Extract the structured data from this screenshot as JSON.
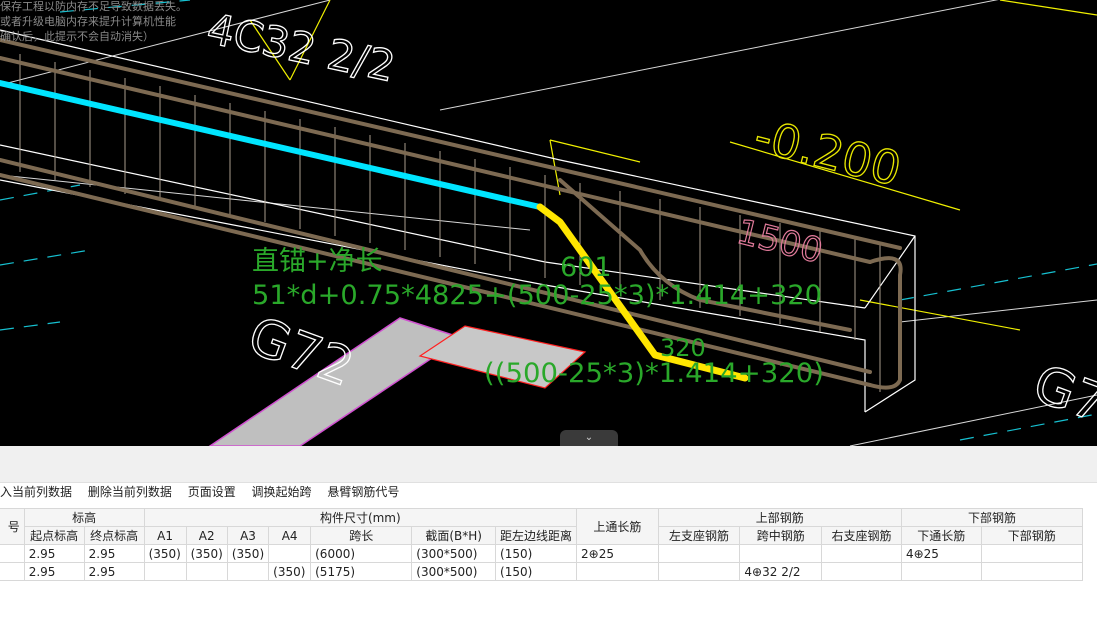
{
  "viewport": {
    "notices": [
      "保存工程以防内存不足导致数据丢失。",
      "或者升级电脑内存来提升计算机性能",
      "确认后，此提示不会自动消失）"
    ],
    "labels": {
      "rebar_mark": "4C32 2/2",
      "elevation": "-0.200",
      "code_mid": "G72",
      "code_right": "G7",
      "value_1500": "1500",
      "formula_title": "直锚+净长",
      "formula_id": "601",
      "formula_expr": "51*d+0.75*4825+(500-25*3)*1.414+320",
      "formula_sub_a": "320",
      "formula_sub_b": "((500-25*3)*1.414+320)"
    },
    "colors": {
      "background": "#000000",
      "highlight_cyan": "#00e5ff",
      "highlight_yellow": "#ffe600",
      "formula_green": "#2aa82a",
      "dimension_yellow": "#f0f000",
      "annotation_pink": "#e07a9a"
    },
    "collapse_icon": "chevron-down-icon"
  },
  "toolbar": {
    "items": [
      "入当前列数据",
      "删除当前列数据",
      "页面设置",
      "调换起始跨",
      "悬臂钢筋代号"
    ]
  },
  "grid": {
    "group_headers": {
      "num": "号",
      "elevation": "标高",
      "dims": "构件尺寸(mm)",
      "top_long": "上通长筋",
      "top_rebar": "上部钢筋",
      "bottom_rebar": "下部钢筋"
    },
    "sub_headers": [
      "起点标高",
      "终点标高",
      "A1",
      "A2",
      "A3",
      "A4",
      "跨长",
      "截面(B*H)",
      "距左边线距离",
      "左支座钢筋",
      "跨中钢筋",
      "右支座钢筋",
      "下通长筋",
      "下部钢筋"
    ],
    "rows": [
      [
        "",
        "2.95",
        "2.95",
        "(350)",
        "(350)",
        "(350)",
        "",
        "(6000)",
        "(300*500)",
        "(150)",
        "2⊕25",
        "",
        "",
        "",
        "4⊕25",
        ""
      ],
      [
        "",
        "2.95",
        "2.95",
        "",
        "",
        "",
        "(350)",
        "(5175)",
        "(300*500)",
        "(150)",
        "",
        "",
        "4⊕32 2/2",
        "",
        "",
        ""
      ]
    ]
  }
}
